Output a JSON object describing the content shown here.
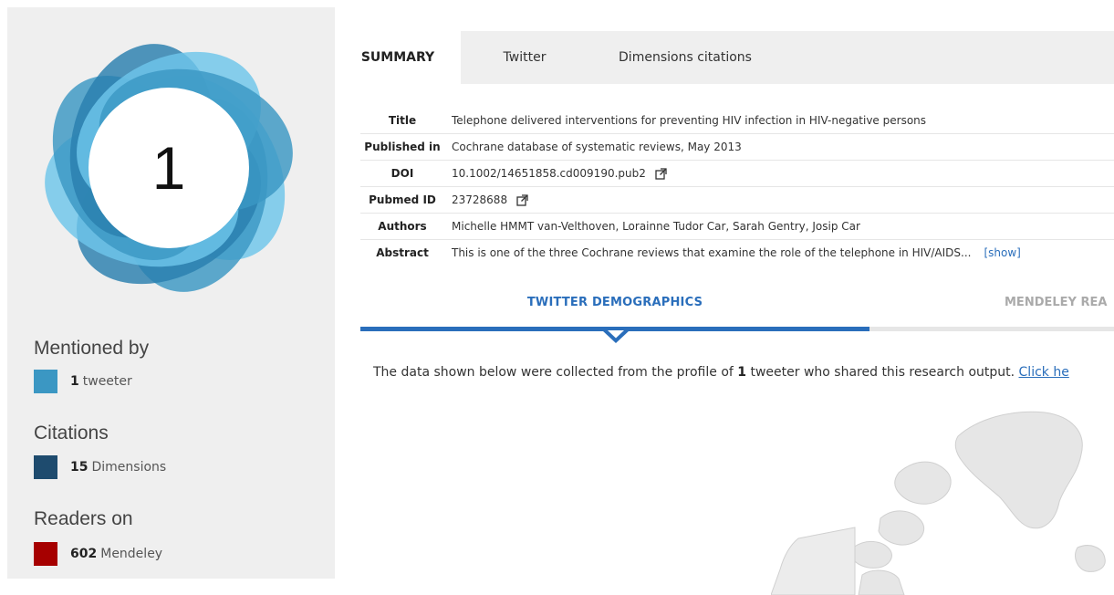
{
  "score": "1",
  "sidebar": {
    "mentioned_by": {
      "heading": "Mentioned by",
      "items": [
        {
          "count": "1",
          "label": "tweeter",
          "color": "#3b97c3"
        }
      ]
    },
    "citations": {
      "heading": "Citations",
      "items": [
        {
          "count": "15",
          "label": "Dimensions",
          "color": "#1e4b6e"
        }
      ]
    },
    "readers": {
      "heading": "Readers on",
      "items": [
        {
          "count": "602",
          "label": "Mendeley",
          "color": "#a60000"
        }
      ]
    }
  },
  "tabs": [
    {
      "label": "SUMMARY",
      "active": true
    },
    {
      "label": "Twitter",
      "active": false
    },
    {
      "label": "Dimensions citations",
      "active": false
    }
  ],
  "summary": {
    "title": {
      "label": "Title",
      "value": "Telephone delivered interventions for preventing HIV infection in HIV-negative persons"
    },
    "published_in": {
      "label": "Published in",
      "value": "Cochrane database of systematic reviews, May 2013"
    },
    "doi": {
      "label": "DOI",
      "value": "10.1002/14651858.cd009190.pub2"
    },
    "pubmed_id": {
      "label": "Pubmed ID",
      "value": "23728688"
    },
    "authors": {
      "label": "Authors",
      "value": "Michelle HMMT van-Velthoven, Lorainne Tudor Car, Sarah Gentry, Josip Car"
    },
    "abstract": {
      "label": "Abstract",
      "value": "This is one of the three Cochrane reviews that examine the role of the telephone in HIV/AIDS...",
      "show_label": "[show]"
    }
  },
  "demographics": {
    "tab_twitter": "TWITTER DEMOGRAPHICS",
    "tab_mendeley": "MENDELEY REA",
    "text_before": "The data shown below were collected from the profile of ",
    "count": "1",
    "text_after": " tweeter who shared this research output. ",
    "link": "Click he"
  },
  "colors": {
    "accent": "#2a6ebb",
    "donut_light": "#6ec6ea",
    "donut_mid": "#3b97c3",
    "donut_dark": "#2a7fae"
  }
}
